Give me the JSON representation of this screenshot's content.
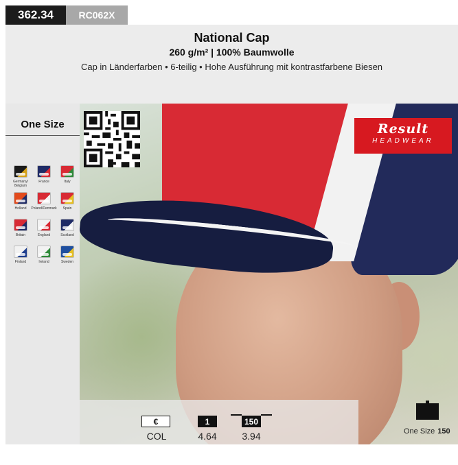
{
  "code": {
    "number": "362.34",
    "sku": "RC062X"
  },
  "product": {
    "title": "National Cap",
    "subtitle": "260 g/m² | 100% Baumwolle",
    "description": "Cap in Länderfarben • 6-teilig • Hohe Ausführung mit kontrastfarbene Biesen"
  },
  "sizes": {
    "label": "One Size"
  },
  "swatches": [
    {
      "label": "Germany/ Belgium",
      "color": "#1a1a1a",
      "accent": "#d4a017"
    },
    {
      "label": "France",
      "color": "#1f2b66",
      "accent": "#d82a34"
    },
    {
      "label": "Italy",
      "color": "#d82a34",
      "accent": "#2f8a3a"
    },
    {
      "label": "Holland",
      "color": "#e24a1c",
      "accent": "#1f2b66"
    },
    {
      "label": "Poland/Denmark",
      "color": "#d82a34",
      "accent": "#f2f2f2"
    },
    {
      "label": "Spain",
      "color": "#d82a34",
      "accent": "#e8c020"
    },
    {
      "label": "Britain",
      "color": "#d82a34",
      "accent": "#1f2b66"
    },
    {
      "label": "England",
      "color": "#f2f2f2",
      "accent": "#d82a34"
    },
    {
      "label": "Scotland",
      "color": "#1f2b66",
      "accent": "#f2f2f2"
    },
    {
      "label": "Finland",
      "color": "#f2f2f2",
      "accent": "#1f3f8f"
    },
    {
      "label": "Ireland",
      "color": "#f2f2f2",
      "accent": "#2f8a3a"
    },
    {
      "label": "Sweden",
      "color": "#1f4f9f",
      "accent": "#e8c020"
    }
  ],
  "brand": {
    "name": "Result",
    "line": "HEADWEAR",
    "color": "#d71920"
  },
  "pricing": {
    "currency_label": "€",
    "qty1_label": "1",
    "qty2_label": "150",
    "color_label": "COL",
    "price_1": "4.64",
    "price_150": "3.94"
  },
  "carton": {
    "size_label": "One Size",
    "quantity": "150"
  }
}
